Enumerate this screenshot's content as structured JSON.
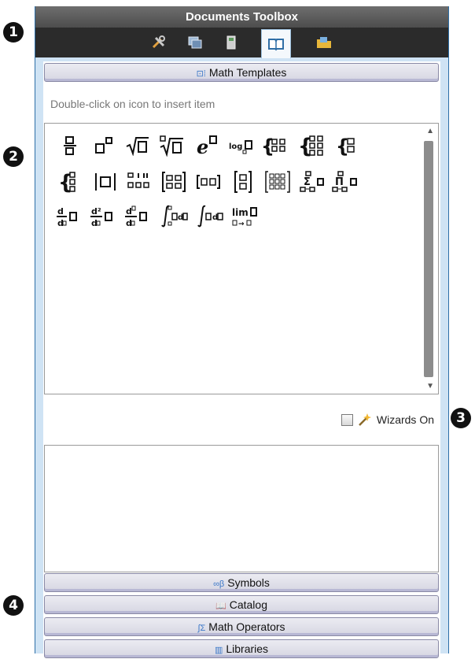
{
  "callouts": [
    "1",
    "2",
    "3",
    "4"
  ],
  "panel": {
    "title": "Documents Toolbox",
    "tabs": [
      {
        "name": "tools-icon",
        "glyph": "⚒"
      },
      {
        "name": "page-sorter-icon",
        "glyph": "▣"
      },
      {
        "name": "scratchpad-icon",
        "glyph": "▮"
      },
      {
        "name": "utilities-book-icon",
        "glyph": "📖"
      },
      {
        "name": "content-explorer-icon",
        "glyph": "📂"
      }
    ]
  },
  "math_templates": {
    "header": "Math Templates",
    "hint": "Double-click on icon to insert item",
    "templates": [
      "fraction-template",
      "exponent-template",
      "square-root-template",
      "nth-root-template",
      "e-exponent-template",
      "log-template",
      "piecewise-2-template",
      "piecewise-n-template",
      "system-2-template",
      "system-n-template",
      "absolute-value-template",
      "degree-minutes-seconds-template",
      "matrix-2x2-template",
      "row-matrix-template",
      "column-matrix-template",
      "matrix-mxn-template",
      "sum-template",
      "product-template",
      "first-derivative-template",
      "second-derivative-template",
      "nth-derivative-template",
      "definite-integral-template",
      "indefinite-integral-template",
      "limit-template"
    ],
    "limit_text": "lim",
    "log_text": "log",
    "e_text": "e"
  },
  "wizards": {
    "label": "Wizards On",
    "checked": false
  },
  "sections": {
    "symbols": "Symbols",
    "catalog": "Catalog",
    "math_operators": "Math Operators",
    "libraries": "Libraries"
  }
}
